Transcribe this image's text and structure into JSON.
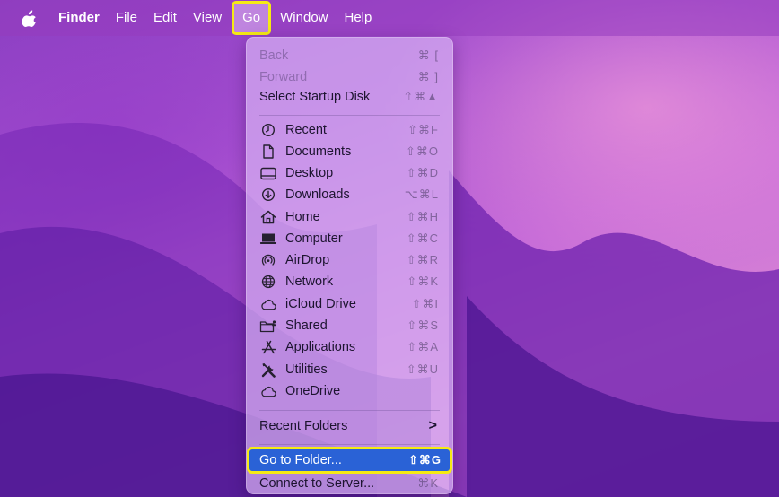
{
  "menubar": {
    "apple_icon": "apple-logo-icon",
    "items": [
      "Finder",
      "File",
      "Edit",
      "View",
      "Go",
      "Window",
      "Help"
    ]
  },
  "go_menu": {
    "nav": [
      {
        "label": "Back",
        "shortcut": "⌘ [",
        "enabled": false
      },
      {
        "label": "Forward",
        "shortcut": "⌘ ]",
        "enabled": false
      },
      {
        "label": "Select Startup Disk",
        "shortcut": "⇧⌘▲",
        "enabled": true
      }
    ],
    "places": [
      {
        "label": "Recent",
        "shortcut": "⇧⌘F",
        "icon": "clock-icon"
      },
      {
        "label": "Documents",
        "shortcut": "⇧⌘O",
        "icon": "document-icon"
      },
      {
        "label": "Desktop",
        "shortcut": "⇧⌘D",
        "icon": "desktop-icon"
      },
      {
        "label": "Downloads",
        "shortcut": "⌥⌘L",
        "icon": "download-icon"
      },
      {
        "label": "Home",
        "shortcut": "⇧⌘H",
        "icon": "home-icon"
      },
      {
        "label": "Computer",
        "shortcut": "⇧⌘C",
        "icon": "laptop-icon"
      },
      {
        "label": "AirDrop",
        "shortcut": "⇧⌘R",
        "icon": "airdrop-icon"
      },
      {
        "label": "Network",
        "shortcut": "⇧⌘K",
        "icon": "globe-icon"
      },
      {
        "label": "iCloud Drive",
        "shortcut": "⇧⌘I",
        "icon": "cloud-icon"
      },
      {
        "label": "Shared",
        "shortcut": "⇧⌘S",
        "icon": "shared-folder-icon"
      },
      {
        "label": "Applications",
        "shortcut": "⇧⌘A",
        "icon": "applications-icon"
      },
      {
        "label": "Utilities",
        "shortcut": "⇧⌘U",
        "icon": "utilities-icon"
      },
      {
        "label": "OneDrive",
        "shortcut": "",
        "icon": "cloud-icon"
      }
    ],
    "recent_folders": {
      "label": "Recent Folders",
      "submenu_indicator": ">"
    },
    "go_to_folder": {
      "label": "Go to Folder...",
      "shortcut": "⇧⌘G",
      "highlighted": true
    },
    "connect_to_server": {
      "label": "Connect to Server...",
      "shortcut": "⌘K"
    }
  },
  "colors": {
    "highlight": "#2a62d6",
    "annotation_box": "#f5ea14",
    "menu_background": "#d6aff2"
  }
}
